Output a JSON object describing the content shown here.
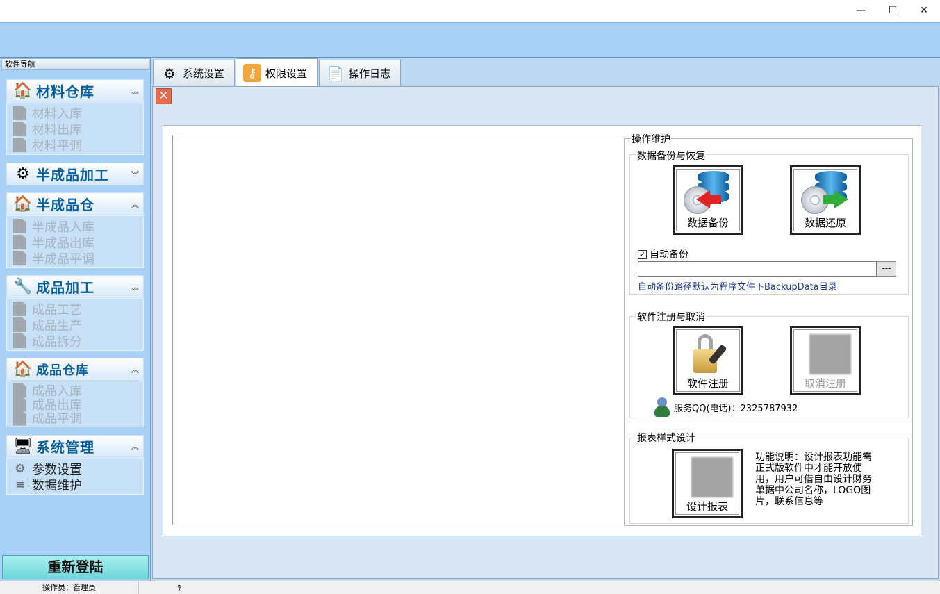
{
  "window": {
    "minimize": "—",
    "maximize": "☐",
    "close": "✕"
  },
  "nav": {
    "title": "软件导航",
    "groups": [
      {
        "label": "材料仓库",
        "items": [
          "材料入库",
          "材料出库",
          "材料平调"
        ]
      },
      {
        "label": "半成品加工",
        "items": []
      },
      {
        "label": "半成品仓",
        "items": [
          "半成品入库",
          "半成品出库",
          "半成品平调"
        ]
      },
      {
        "label": "成品加工",
        "items": [
          "成品工艺",
          "成品生产",
          "成品拆分"
        ]
      },
      {
        "label": "成品仓库",
        "items": [
          "成品入库",
          "成品出库",
          "成品平调"
        ]
      },
      {
        "label": "系统管理",
        "items": [
          "参数设置",
          "数据维护"
        ]
      }
    ],
    "relogin": "重新登陆"
  },
  "status": {
    "operator": "操作员：管理员",
    "extra": "ﾗ"
  },
  "tabs": [
    {
      "label": "系统设置",
      "icon": "gear-icon"
    },
    {
      "label": "权限设置",
      "icon": "key-icon"
    },
    {
      "label": "操作日志",
      "icon": "document-icon"
    }
  ],
  "ops": {
    "title": "操作维护",
    "backup_section": "数据备份与恢复",
    "backup_btn": "数据备份",
    "restore_btn": "数据还原",
    "auto_backup": "自动备份",
    "auto_backup_checked": true,
    "path_value": "",
    "browse_label": "---",
    "path_hint": "自动备份路径默认为程序文件下BackupData目录",
    "register_section": "软件注册与取消",
    "register_btn": "软件注册",
    "unregister_btn": "取消注册",
    "service": "服务QQ(电话)：2325787932",
    "report_section": "报表样式设计",
    "report_btn": "设计报表",
    "report_desc": "功能说明：设计报表功能需正式版软件中才能开放使用，用户可借自由设计财务单据中公司名称，LOGO图片，联系信息等"
  },
  "colors": {
    "band": "#a9d1f7",
    "nav_label": "#0a5f9f",
    "hint": "#1e3c8c"
  }
}
